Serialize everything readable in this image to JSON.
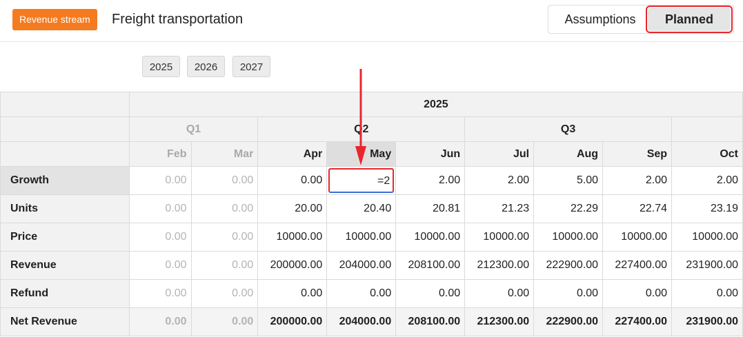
{
  "header": {
    "badge": "Revenue stream",
    "title": "Freight transportation",
    "toggle": {
      "assumptions": "Assumptions",
      "planned": "Planned"
    }
  },
  "years": [
    "2025",
    "2026",
    "2027"
  ],
  "table": {
    "year_header": "2025",
    "quarters": [
      "Q1",
      "Q2",
      "Q3"
    ],
    "months": [
      "Feb",
      "Mar",
      "Apr",
      "May",
      "Jun",
      "Jul",
      "Aug",
      "Sep",
      "Oct"
    ],
    "rows": [
      {
        "label": "Growth",
        "values": [
          "0.00",
          "0.00",
          "0.00",
          "=2",
          "2.00",
          "2.00",
          "5.00",
          "2.00",
          "2.00"
        ]
      },
      {
        "label": "Units",
        "values": [
          "0.00",
          "0.00",
          "20.00",
          "20.40",
          "20.81",
          "21.23",
          "22.29",
          "22.74",
          "23.19"
        ]
      },
      {
        "label": "Price",
        "values": [
          "0.00",
          "0.00",
          "10000.00",
          "10000.00",
          "10000.00",
          "10000.00",
          "10000.00",
          "10000.00",
          "10000.00"
        ]
      },
      {
        "label": "Revenue",
        "values": [
          "0.00",
          "0.00",
          "200000.00",
          "204000.00",
          "208100.00",
          "212300.00",
          "222900.00",
          "227400.00",
          "231900.00"
        ]
      },
      {
        "label": "Refund",
        "values": [
          "0.00",
          "0.00",
          "0.00",
          "0.00",
          "0.00",
          "0.00",
          "0.00",
          "0.00",
          "0.00"
        ]
      },
      {
        "label": "Net Revenue",
        "values": [
          "0.00",
          "0.00",
          "200000.00",
          "204000.00",
          "208100.00",
          "212300.00",
          "222900.00",
          "227400.00",
          "231900.00"
        ]
      }
    ]
  },
  "colors": {
    "badge": "#f47b20",
    "highlight": "#e8262d"
  }
}
